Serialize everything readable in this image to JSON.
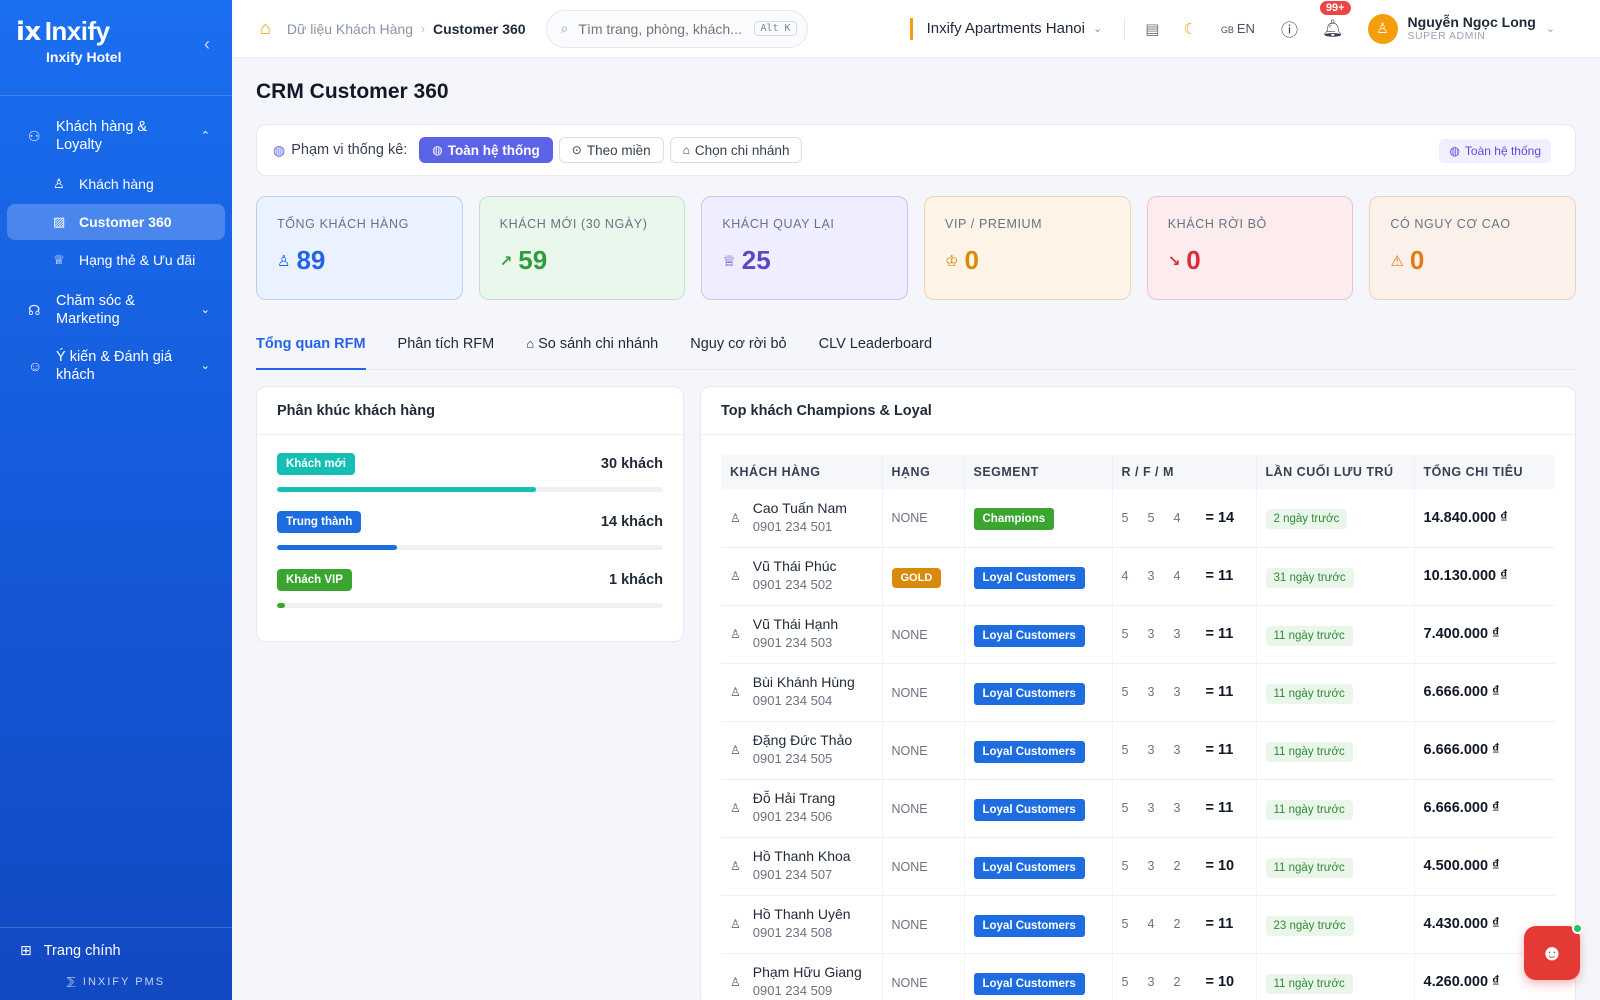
{
  "brand": {
    "logo": "Inxify",
    "sub": "Inxify Hotel",
    "pms": "INXIFY PMS"
  },
  "sidebar": {
    "groups": [
      {
        "label": "Khách hàng & Loyalty",
        "icon": "users-icon",
        "expanded": true,
        "items": [
          {
            "label": "Khách hàng",
            "icon": "user-icon"
          },
          {
            "label": "Customer 360",
            "icon": "chart-icon",
            "active": true
          },
          {
            "label": "Hạng thẻ & Ưu đãi",
            "icon": "trophy-icon"
          }
        ]
      },
      {
        "label": "Chăm sóc & Marketing",
        "icon": "headset-icon",
        "expanded": false
      },
      {
        "label": "Ý kiến & Đánh giá khách",
        "icon": "chat-icon",
        "expanded": false
      }
    ],
    "home": "Trang chính"
  },
  "header": {
    "breadcrumb": [
      "Dữ liệu Khách Hàng",
      "Customer 360"
    ],
    "search_placeholder": "Tìm trang, phòng, khách...",
    "search_shortcut": "Alt K",
    "branch": "Inxify Apartments Hanoi",
    "lang_flag": "GB",
    "lang": "EN",
    "notif_count": "99+",
    "user_name": "Nguyễn Ngọc Long",
    "user_role": "SUPER ADMIN"
  },
  "page": {
    "title": "CRM Customer 360",
    "scope_label": "Phạm vi thống kê:",
    "scope_options": [
      "Toàn hệ thống",
      "Theo miền",
      "Chọn chi nhánh"
    ],
    "scope_tag": "Toàn hệ thống"
  },
  "stats": [
    {
      "label": "TỔNG KHÁCH HÀNG",
      "value": "89"
    },
    {
      "label": "KHÁCH MỚI (30 NGÀY)",
      "value": "59"
    },
    {
      "label": "KHÁCH QUAY LẠI",
      "value": "25"
    },
    {
      "label": "VIP / PREMIUM",
      "value": "0"
    },
    {
      "label": "KHÁCH RỜI BỎ",
      "value": "0"
    },
    {
      "label": "CÓ NGUY CƠ CAO",
      "value": "0"
    }
  ],
  "tabs": [
    "Tổng quan RFM",
    "Phân tích RFM",
    "So sánh chi nhánh",
    "Nguy cơ rời bỏ",
    "CLV Leaderboard"
  ],
  "segments": {
    "title": "Phân khúc khách hàng",
    "rows": [
      {
        "label": "Khách mới",
        "count": "30 khách",
        "fraction": 0.67,
        "color": "#15bfb4"
      },
      {
        "label": "Trung thành",
        "count": "14 khách",
        "fraction": 0.31,
        "color": "#1d6de0"
      },
      {
        "label": "Khách VIP",
        "count": "1 khách",
        "fraction": 0.022,
        "color": "#3aa62f"
      }
    ]
  },
  "top_customers": {
    "title": "Top khách Champions & Loyal",
    "columns": [
      "KHÁCH HÀNG",
      "HẠNG",
      "SEGMENT",
      "R / F / M",
      "LẦN CUỐI LƯU TRÚ",
      "TỔNG CHI TIÊU"
    ],
    "rows": [
      {
        "name": "Cao Tuấn Nam",
        "phone": "0901 234 501",
        "tier": "NONE",
        "segment": "Champions",
        "r": "5",
        "f": "5",
        "m": "4",
        "total": "= 14",
        "last": "2 ngày trước",
        "spend": "14.840.000 ₫"
      },
      {
        "name": "Vũ Thái Phúc",
        "phone": "0901 234 502",
        "tier": "GOLD",
        "segment": "Loyal Customers",
        "r": "4",
        "f": "3",
        "m": "4",
        "total": "= 11",
        "last": "31 ngày trước",
        "spend": "10.130.000 ₫"
      },
      {
        "name": "Vũ Thái Hạnh",
        "phone": "0901 234 503",
        "tier": "NONE",
        "segment": "Loyal Customers",
        "r": "5",
        "f": "3",
        "m": "3",
        "total": "= 11",
        "last": "11 ngày trước",
        "spend": "7.400.000 ₫"
      },
      {
        "name": "Bùi Khánh Hùng",
        "phone": "0901 234 504",
        "tier": "NONE",
        "segment": "Loyal Customers",
        "r": "5",
        "f": "3",
        "m": "3",
        "total": "= 11",
        "last": "11 ngày trước",
        "spend": "6.666.000 ₫"
      },
      {
        "name": "Đặng Đức Thảo",
        "phone": "0901 234 505",
        "tier": "NONE",
        "segment": "Loyal Customers",
        "r": "5",
        "f": "3",
        "m": "3",
        "total": "= 11",
        "last": "11 ngày trước",
        "spend": "6.666.000 ₫"
      },
      {
        "name": "Đỗ Hải Trang",
        "phone": "0901 234 506",
        "tier": "NONE",
        "segment": "Loyal Customers",
        "r": "5",
        "f": "3",
        "m": "3",
        "total": "= 11",
        "last": "11 ngày trước",
        "spend": "6.666.000 ₫"
      },
      {
        "name": "Hồ Thanh Khoa",
        "phone": "0901 234 507",
        "tier": "NONE",
        "segment": "Loyal Customers",
        "r": "5",
        "f": "3",
        "m": "2",
        "total": "= 10",
        "last": "11 ngày trước",
        "spend": "4.500.000 ₫"
      },
      {
        "name": "Hồ Thanh Uyên",
        "phone": "0901 234 508",
        "tier": "NONE",
        "segment": "Loyal Customers",
        "r": "5",
        "f": "4",
        "m": "2",
        "total": "= 11",
        "last": "23 ngày trước",
        "spend": "4.430.000 ₫"
      },
      {
        "name": "Phạm Hữu Giang",
        "phone": "0901 234 509",
        "tier": "NONE",
        "segment": "Loyal Customers",
        "r": "5",
        "f": "3",
        "m": "2",
        "total": "= 10",
        "last": "11 ngày trước",
        "spend": "4.260.000 ₫"
      }
    ]
  }
}
